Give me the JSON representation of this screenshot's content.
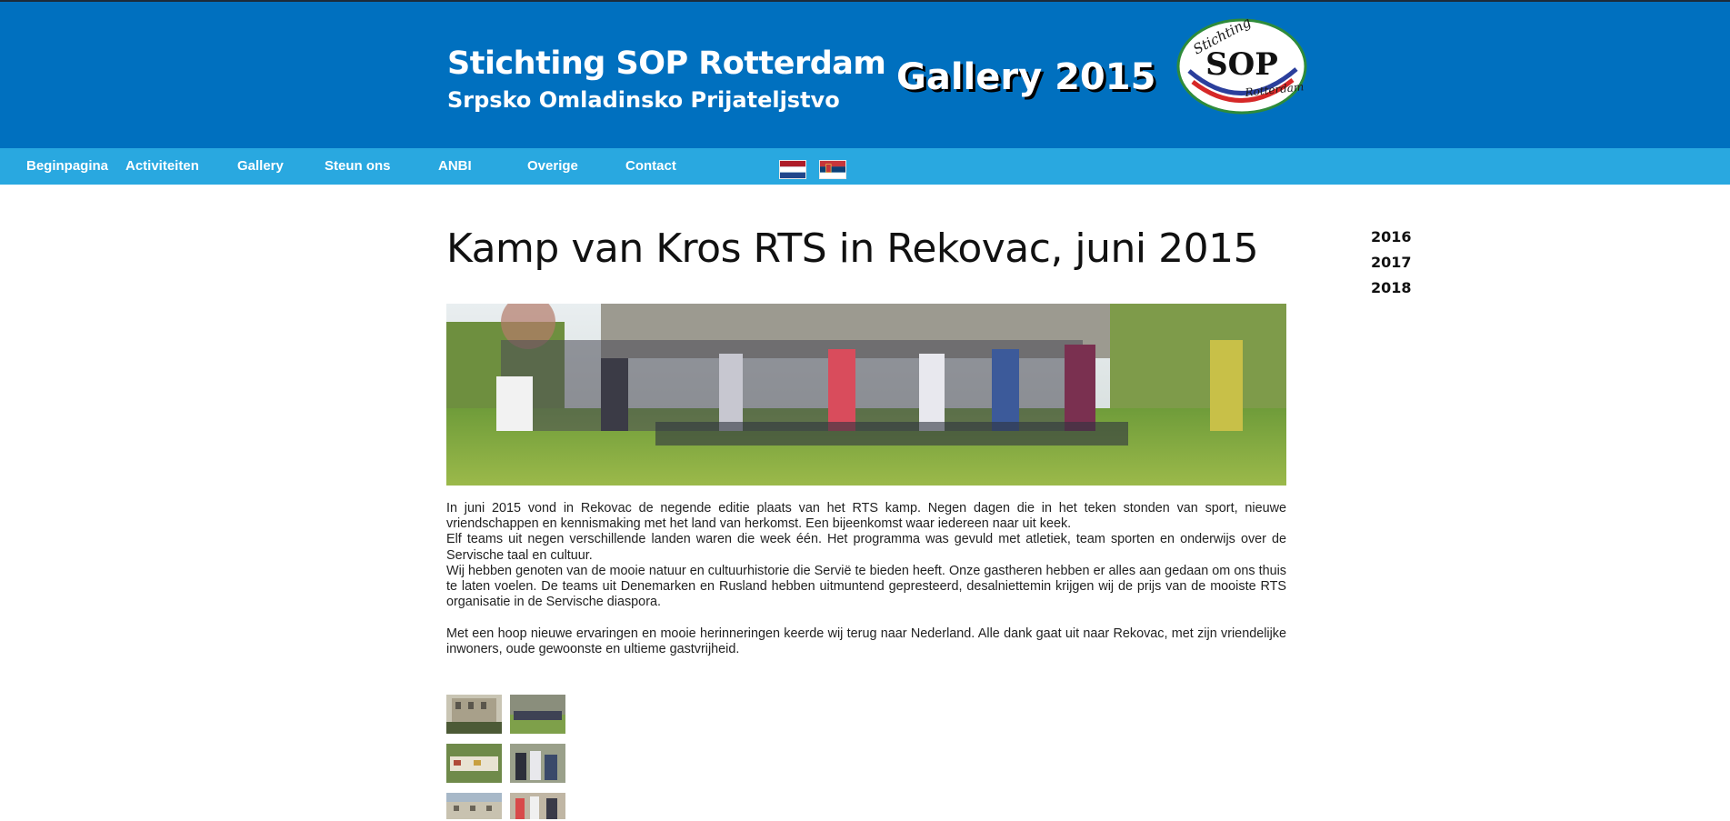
{
  "header": {
    "site_title": "Stichting SOP Rotterdam",
    "site_subtitle": "Srpsko Omladinsko Prijateljstvo",
    "gallery_title": "Gallery 2015",
    "logo": {
      "arc_top_text": "Stichting",
      "main_text": "SOP",
      "arc_bottom_text": "Rotterdam"
    },
    "colors": {
      "header_bg": "#0070bf",
      "nav_bg": "#29a8e0"
    }
  },
  "nav": {
    "items": [
      "Beginpagina",
      "Activiteiten",
      "Gallery",
      "Steun ons",
      "ANBI",
      "Overige",
      "Contact"
    ],
    "flags": [
      "dutch-flag-icon",
      "serbian-flag-icon"
    ]
  },
  "main": {
    "heading": "Kamp van Kros RTS in Rekovac, juni 2015",
    "paragraphs": [
      "In juni 2015 vond in Rekovac de negende editie plaats van het RTS kamp. Negen dagen die in het teken stonden van sport, nieuwe vriendschappen en kennismaking met het land van herkomst. Een bijeenkomst waar iedereen naar uit keek.",
      "Elf teams uit negen verschillende landen waren die week één. Het programma was gevuld met atletiek, team sporten en onderwijs over de Servische taal en cultuur.",
      "Wij hebben genoten van de mooie natuur en cultuurhistorie die Servië te bieden heeft. Onze gastheren hebben er alles aan gedaan om ons thuis te laten voelen. De teams uit Denemarken en Rusland hebben uitmuntend gepresteerd, desalniettemin krijgen wij de prijs van de mooiste RTS organisatie in de Servische diaspora.",
      "Met een hoop nieuwe ervaringen en mooie herinneringen keerde wij terug naar Nederland. Alle dank gaat uit naar Rekovac, met zijn vriendelijke inwoners, oude gewoonste en ultieme gastvrijheid."
    ]
  },
  "sidebar": {
    "years": [
      "2016",
      "2017",
      "2018"
    ]
  }
}
